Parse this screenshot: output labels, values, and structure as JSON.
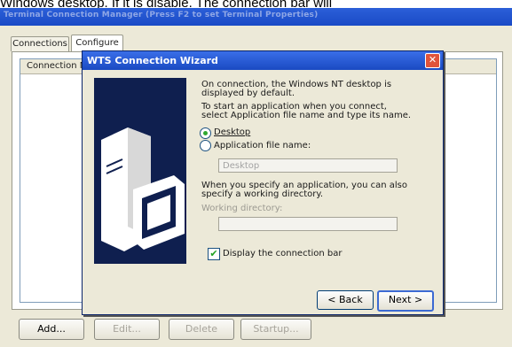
{
  "caption": "Windows desktop. If it is disable. The connection bar will",
  "window": {
    "title": "Terminal Connection Manager (Press F2 to set Terminal Properties)"
  },
  "tabs": [
    {
      "label": "Connections"
    },
    {
      "label": "Configure"
    }
  ],
  "list": {
    "column_header": "Connection N"
  },
  "buttons": {
    "add": "Add...",
    "edit": "Edit...",
    "delete": "Delete",
    "startup": "Startup..."
  },
  "dialog": {
    "title": "WTS Connection Wizard",
    "intro_line1": "On connection, the Windows NT desktop is",
    "intro_line2": "displayed by default.",
    "intro_line3": "To start an application when you connect,",
    "intro_line4": "select Application file name and type its name.",
    "radio_desktop": "Desktop",
    "radio_app": "Application file name:",
    "app_field_value": "Desktop",
    "workdir_line1": "When you specify an application, you can also",
    "workdir_line2": "specify a working directory.",
    "workdir_label": "Working directory:",
    "workdir_value": "",
    "checkbox_label": "Display the connection bar",
    "back": "< Back",
    "next": "Next >"
  },
  "state": {
    "selected_radio": "Desktop",
    "connection_bar_checked": true
  }
}
